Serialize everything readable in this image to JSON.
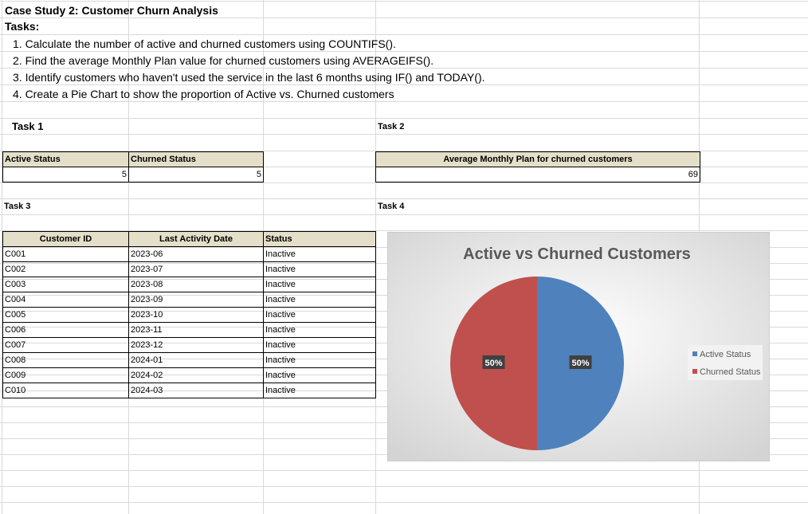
{
  "sheet": {
    "title": "Case Study 2: Customer Churn Analysis",
    "tasks_label": "Tasks:",
    "tasks": [
      "1. Calculate the number of active and churned customers using COUNTIFS().",
      "2. Find the average Monthly Plan value for churned customers using AVERAGEIFS().",
      "3. Identify customers who haven't used the service in the last 6 months using IF() and TODAY().",
      "4. Create a Pie Chart to show the proportion of Active vs. Churned customers"
    ]
  },
  "task1": {
    "heading": "Task 1",
    "active_header": "Active Status",
    "churned_header": "Churned Status",
    "active_value": "5",
    "churned_value": "5"
  },
  "task2": {
    "heading": "Task 2",
    "header": "Average Monthly Plan for churned customers",
    "value": "69"
  },
  "task3": {
    "heading": "Task 3",
    "columns": [
      "Customer ID",
      "Last Activity Date",
      "Status"
    ],
    "rows": [
      [
        "C001",
        "2023-06",
        "Inactive"
      ],
      [
        "C002",
        "2023-07",
        "Inactive"
      ],
      [
        "C003",
        "2023-08",
        "Inactive"
      ],
      [
        "C004",
        "2023-09",
        "Inactive"
      ],
      [
        "C005",
        "2023-10",
        "Inactive"
      ],
      [
        "C006",
        "2023-11",
        "Inactive"
      ],
      [
        "C007",
        "2023-12",
        "Inactive"
      ],
      [
        "C008",
        "2024-01",
        "Inactive"
      ],
      [
        "C009",
        "2024-02",
        "Inactive"
      ],
      [
        "C010",
        "2024-03",
        "Inactive"
      ]
    ]
  },
  "task4": {
    "heading": "Task 4"
  },
  "chart_data": {
    "type": "pie",
    "title": "Active vs Churned Customers",
    "categories": [
      "Active Status",
      "Churned Status"
    ],
    "values": [
      5,
      5
    ],
    "data_labels": [
      "50%",
      "50%"
    ],
    "colors": [
      "#4f81bd",
      "#c0504d"
    ],
    "legend_position": "right"
  }
}
